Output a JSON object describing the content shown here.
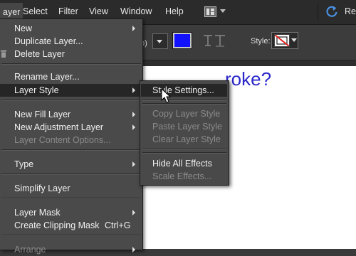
{
  "menubar": {
    "items": [
      {
        "label": "ayer"
      },
      {
        "label": "Select"
      },
      {
        "label": "Filter"
      },
      {
        "label": "View"
      },
      {
        "label": "Window"
      },
      {
        "label": "Help"
      }
    ],
    "layout_icon": "layout-grid-icon",
    "redo_icon": "redo-icon",
    "redo_label": "Re"
  },
  "options_bar": {
    "partial_text": "p)",
    "text_color": "#1212ff",
    "style_label": "Style:",
    "style_swatch": "no-style-icon"
  },
  "canvas": {
    "text": "roke?"
  },
  "layer_menu": {
    "items": [
      {
        "label": "New",
        "submenu": true,
        "disabled": false
      },
      {
        "label": "Duplicate Layer...",
        "disabled": false
      },
      {
        "label": "Delete Layer",
        "icon": "trash-icon",
        "disabled": false
      },
      {
        "label": "Rename Layer...",
        "disabled": false
      },
      {
        "label": "Layer Style",
        "submenu": true,
        "highlighted": true,
        "disabled": false
      },
      {
        "label": "New Fill Layer",
        "submenu": true,
        "disabled": false
      },
      {
        "label": "New Adjustment Layer",
        "submenu": true,
        "disabled": false
      },
      {
        "label": "Layer Content Options...",
        "disabled": true
      },
      {
        "label": "Type",
        "submenu": true,
        "disabled": false
      },
      {
        "label": "Simplify Layer",
        "disabled": false
      },
      {
        "label": "Layer Mask",
        "submenu": true,
        "disabled": false
      },
      {
        "label": "Create Clipping Mask",
        "shortcut": "Ctrl+G",
        "disabled": false
      },
      {
        "label": "Arrange",
        "submenu": true,
        "disabled": true
      }
    ]
  },
  "layer_style_submenu": {
    "items": [
      {
        "label": "Style Settings...",
        "highlighted": true,
        "disabled": false
      },
      {
        "label": "Copy Layer Style",
        "disabled": true
      },
      {
        "label": "Paste Layer Style",
        "disabled": true
      },
      {
        "label": "Clear Layer Style",
        "disabled": true
      },
      {
        "label": "Hide All Effects",
        "disabled": false
      },
      {
        "label": "Scale Effects...",
        "disabled": true
      }
    ]
  },
  "colors": {
    "menu_bg": "#4a4a4a",
    "highlight_bg": "#262626",
    "disabled_text": "#8a8a8a",
    "canvas_text": "#2a27c9"
  }
}
